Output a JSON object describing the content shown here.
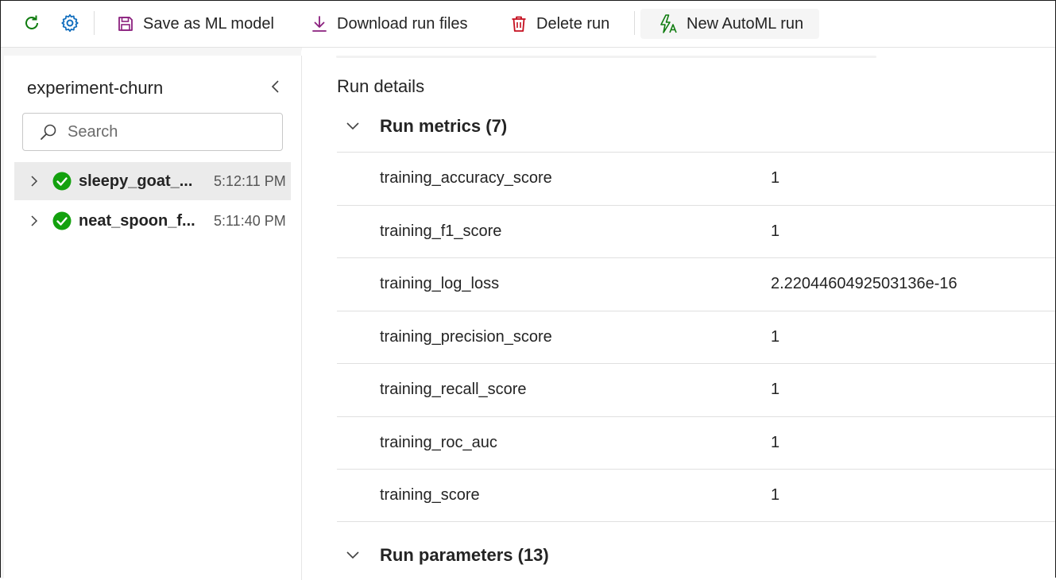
{
  "toolbar": {
    "refresh_icon": "refresh-icon",
    "settings_icon": "gear-icon",
    "save_model_label": "Save as ML model",
    "download_label": "Download run files",
    "delete_label": "Delete run",
    "automl_label": "New AutoML run",
    "colors": {
      "refresh": "#107c10",
      "gear": "#0f6cbd",
      "save": "#8a1f7d",
      "download": "#8a1f7d",
      "delete": "#c50f1f",
      "automl": "#107c10"
    }
  },
  "sidebar": {
    "title": "experiment-churn",
    "search_placeholder": "Search",
    "runs": [
      {
        "name": "sleepy_goat_...",
        "time": "5:12:11 PM",
        "status": "succeeded",
        "selected": true
      },
      {
        "name": "neat_spoon_f...",
        "time": "5:11:40 PM",
        "status": "succeeded",
        "selected": false
      }
    ]
  },
  "main": {
    "heading": "Run details",
    "metrics_section": {
      "title": "Run metrics (7)",
      "expanded": true
    },
    "metrics": [
      {
        "name": "training_accuracy_score",
        "value": "1"
      },
      {
        "name": "training_f1_score",
        "value": "1"
      },
      {
        "name": "training_log_loss",
        "value": "2.2204460492503136e-16"
      },
      {
        "name": "training_precision_score",
        "value": "1"
      },
      {
        "name": "training_recall_score",
        "value": "1"
      },
      {
        "name": "training_roc_auc",
        "value": "1"
      },
      {
        "name": "training_score",
        "value": "1"
      }
    ],
    "parameters_section": {
      "title": "Run parameters (13)",
      "expanded": true
    }
  }
}
